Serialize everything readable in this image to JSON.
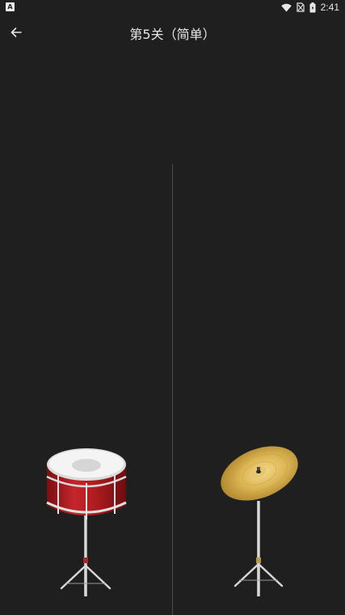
{
  "status_bar": {
    "left_icon_letter": "A",
    "time": "2:41",
    "icons": [
      "wifi-icon",
      "no-sim-icon",
      "battery-icon"
    ]
  },
  "header": {
    "back_icon": "arrow-left-icon",
    "title": "第5关（简单）"
  },
  "instruments": [
    {
      "name": "snare-drum",
      "colors": {
        "shell": "#b01c1e",
        "head": "#f2f2f2"
      }
    },
    {
      "name": "cymbal",
      "colors": {
        "plate": "#d9b24e"
      }
    }
  ],
  "colors": {
    "background": "#1f1f1f",
    "divider": "#4c4c4c",
    "text": "#e6e6e6"
  }
}
